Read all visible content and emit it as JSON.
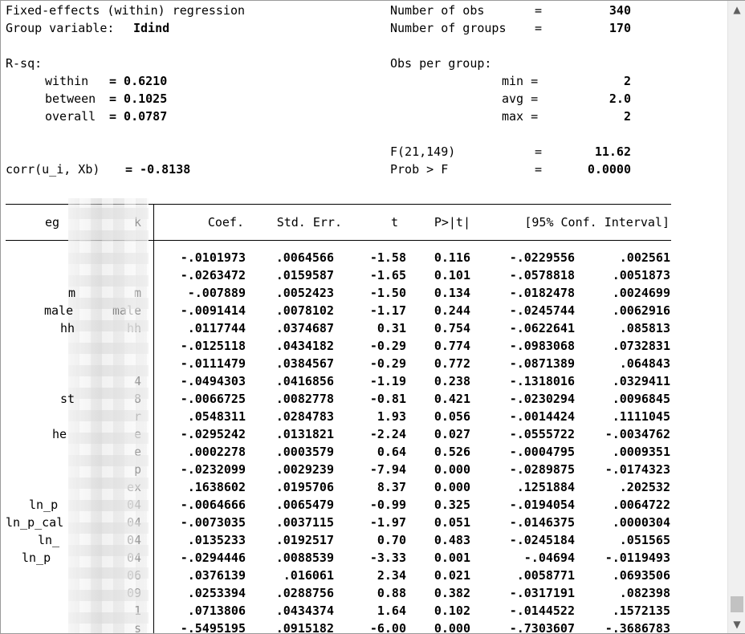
{
  "header": {
    "title": "Fixed-effects (within) regression",
    "group_var_label": "Group variable:",
    "group_var": "Idind",
    "nobs_label": "Number of obs",
    "nobs": "340",
    "ngroups_label": "Number of groups",
    "ngroups": "170",
    "eq": "=",
    "rsq_label": "R-sq:",
    "within_label": "within",
    "within": "= 0.6210",
    "between_label": "between",
    "between": "= 0.1025",
    "overall_label": "overall",
    "overall": "= 0.0787",
    "obs_per_group_label": "Obs per group:",
    "min_label": "min =",
    "min": "2",
    "avg_label": "avg =",
    "avg": "2.0",
    "max_label": "max =",
    "max": "2",
    "f_label": "F(21,149)",
    "f": "11.62",
    "prob_label": "Prob > F",
    "prob": "0.0000",
    "corr_label": "corr(u_i, Xb)",
    "corr": "= -0.8138"
  },
  "table": {
    "depvar_left": "eg",
    "depvar_right": "k",
    "columns": [
      "Coef.",
      "Std. Err.",
      "t",
      "P>|t|",
      "[95% Conf. Interval]"
    ],
    "rows": [
      {
        "label": "",
        "coef": "-.0101973",
        "se": ".0064566",
        "t": "-1.58",
        "p": "0.116",
        "lo": "-.0229556",
        "hi": ".002561"
      },
      {
        "label": "",
        "coef": "-.0263472",
        "se": ".0159587",
        "t": "-1.65",
        "p": "0.101",
        "lo": "-.0578818",
        "hi": ".0051873"
      },
      {
        "label": "m",
        "coef": "-.007889",
        "se": ".0052423",
        "t": "-1.50",
        "p": "0.134",
        "lo": "-.0182478",
        "hi": ".0024699"
      },
      {
        "label": "male",
        "coef": "-.0091414",
        "se": ".0078102",
        "t": "-1.17",
        "p": "0.244",
        "lo": "-.0245744",
        "hi": ".0062916"
      },
      {
        "label": "hh",
        "coef": ".0117744",
        "se": ".0374687",
        "t": "0.31",
        "p": "0.754",
        "lo": "-.0622641",
        "hi": ".085813"
      },
      {
        "label": "",
        "coef": "-.0125118",
        "se": ".0434182",
        "t": "-0.29",
        "p": "0.774",
        "lo": "-.0983068",
        "hi": ".0732831"
      },
      {
        "label": "",
        "coef": "-.0111479",
        "se": ".0384567",
        "t": "-0.29",
        "p": "0.772",
        "lo": "-.0871389",
        "hi": ".064843"
      },
      {
        "label": "4",
        "coef": "-.0494303",
        "se": ".0416856",
        "t": "-1.19",
        "p": "0.238",
        "lo": "-.1318016",
        "hi": ".0329411"
      },
      {
        "label": "8",
        "coef": "-.0066725",
        "se": ".0082778",
        "t": "-0.81",
        "p": "0.421",
        "lo": "-.0230294",
        "hi": ".0096845"
      },
      {
        "label": "r",
        "coef": ".0548311",
        "se": ".0284783",
        "t": "1.93",
        "p": "0.056",
        "lo": "-.0014424",
        "hi": ".1111045"
      },
      {
        "label": "e",
        "coef": "-.0295242",
        "se": ".0131821",
        "t": "-2.24",
        "p": "0.027",
        "lo": "-.0555722",
        "hi": "-.0034762"
      },
      {
        "label": "e",
        "coef": ".0002278",
        "se": ".0003579",
        "t": "0.64",
        "p": "0.526",
        "lo": "-.0004795",
        "hi": ".0009351"
      },
      {
        "label": "p",
        "coef": "-.0232099",
        "se": ".0029239",
        "t": "-7.94",
        "p": "0.000",
        "lo": "-.0289875",
        "hi": "-.0174323"
      },
      {
        "label": "ex",
        "coef": ".1638602",
        "se": ".0195706",
        "t": "8.37",
        "p": "0.000",
        "lo": ".1251884",
        "hi": ".202532"
      },
      {
        "label": "04",
        "coef": "-.0064666",
        "se": ".0065479",
        "t": "-0.99",
        "p": "0.325",
        "lo": "-.0194054",
        "hi": ".0064722"
      },
      {
        "label": "04",
        "coef": "-.0073035",
        "se": ".0037115",
        "t": "-1.97",
        "p": "0.051",
        "lo": "-.0146375",
        "hi": ".0000304"
      },
      {
        "label": "04",
        "coef": ".0135233",
        "se": ".0192517",
        "t": "0.70",
        "p": "0.483",
        "lo": "-.0245184",
        "hi": ".051565"
      },
      {
        "label": "04",
        "coef": "-.0294446",
        "se": ".0088539",
        "t": "-3.33",
        "p": "0.001",
        "lo": "-.04694",
        "hi": "-.0119493"
      },
      {
        "label": "06",
        "coef": ".0376139",
        "se": ".016061",
        "t": "2.34",
        "p": "0.021",
        "lo": ".0058771",
        "hi": ".0693506"
      },
      {
        "label": "09",
        "coef": ".0253394",
        "se": ".0288756",
        "t": "0.88",
        "p": "0.382",
        "lo": "-.0317191",
        "hi": ".082398"
      },
      {
        "label": "1",
        "coef": ".0713806",
        "se": ".0434374",
        "t": "1.64",
        "p": "0.102",
        "lo": "-.0144522",
        "hi": ".1572135"
      },
      {
        "label": "s",
        "coef": "-.5495195",
        "se": ".0915182",
        "t": "-6.00",
        "p": "0.000",
        "lo": "-.7303607",
        "hi": "-.3686783"
      }
    ],
    "left_fragments": [
      "m",
      "male",
      "hh",
      "st",
      "he",
      "ln_p",
      "ln_p_cal",
      "ln_",
      "ln_p"
    ]
  },
  "scrollbar": {
    "up_icon": "chevron-up-icon",
    "down_icon": "chevron-down-icon"
  }
}
